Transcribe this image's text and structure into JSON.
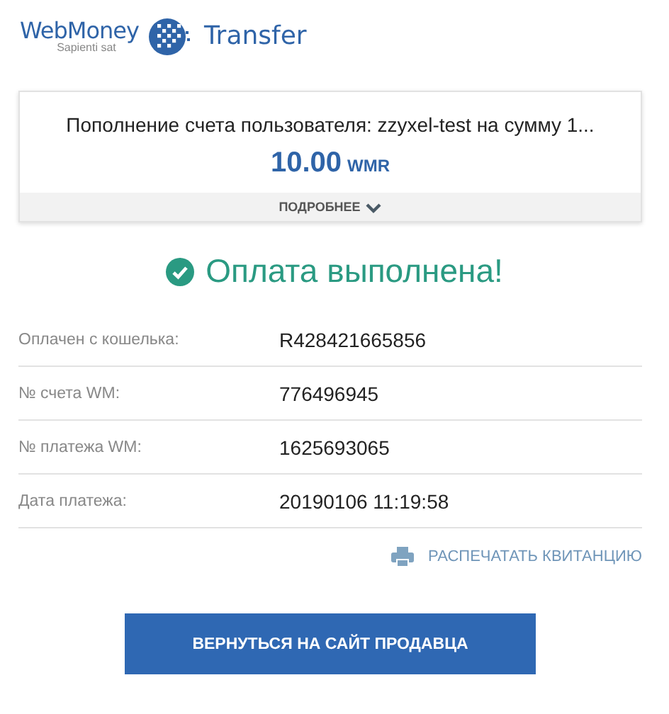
{
  "logo": {
    "brand": "WebMoney",
    "motto": "Sapienti sat",
    "product": "Transfer"
  },
  "summary": {
    "description": "Пополнение счета пользователя: zzyxel-test на сумму 1...",
    "amount": "10.00",
    "currency": "WMR",
    "details_toggle": "ПОДРОБНЕЕ",
    "expanded": false
  },
  "status": {
    "kind": "success",
    "message": "Оплата выполнена!"
  },
  "details": [
    {
      "label": "Оплачен с кошелька:",
      "value": "R428421665856"
    },
    {
      "label": "№ счета WM:",
      "value": "776496945"
    },
    {
      "label": "№ платежа WM:",
      "value": "1625693065"
    },
    {
      "label": "Дата платежа:",
      "value": "20190106 11:19:58"
    }
  ],
  "print_link": "РАСПЕЧАТАТЬ КВИТАНЦИЮ",
  "return_button": "ВЕРНУТЬСЯ НА САЙТ ПРОДАВЦА"
}
